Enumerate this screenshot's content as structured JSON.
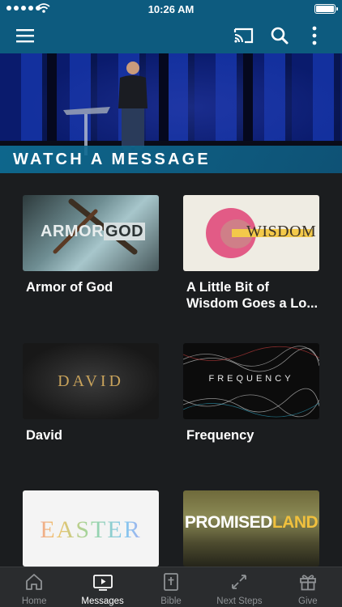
{
  "status_bar": {
    "time": "10:26 AM"
  },
  "hero": {
    "banner_text": "WATCH A MESSAGE"
  },
  "series": [
    {
      "title": "Armor of God",
      "thumb_text": "ARMOR GOD"
    },
    {
      "title": "A Little Bit of Wisdom Goes a Lo...",
      "thumb_text": "WISDOM"
    },
    {
      "title": "David",
      "thumb_text": "DAVID"
    },
    {
      "title": "Frequency",
      "thumb_text": "FREQUENCY"
    },
    {
      "title": "",
      "thumb_text": "EASTER"
    },
    {
      "title": "",
      "thumb_text": "PROMISEDLAND"
    }
  ],
  "tabs": [
    {
      "label": "Home",
      "icon": "home-icon"
    },
    {
      "label": "Messages",
      "icon": "play-icon",
      "active": true
    },
    {
      "label": "Bible",
      "icon": "bible-icon"
    },
    {
      "label": "Next Steps",
      "icon": "next-steps-icon"
    },
    {
      "label": "Give",
      "icon": "gift-icon"
    }
  ],
  "colors": {
    "app_bar": "#0d5b7f",
    "background": "#1b1d1f",
    "tab_bar": "#2a2c2e",
    "active_tab": "#ffffff",
    "inactive_tab": "#8f9295"
  }
}
